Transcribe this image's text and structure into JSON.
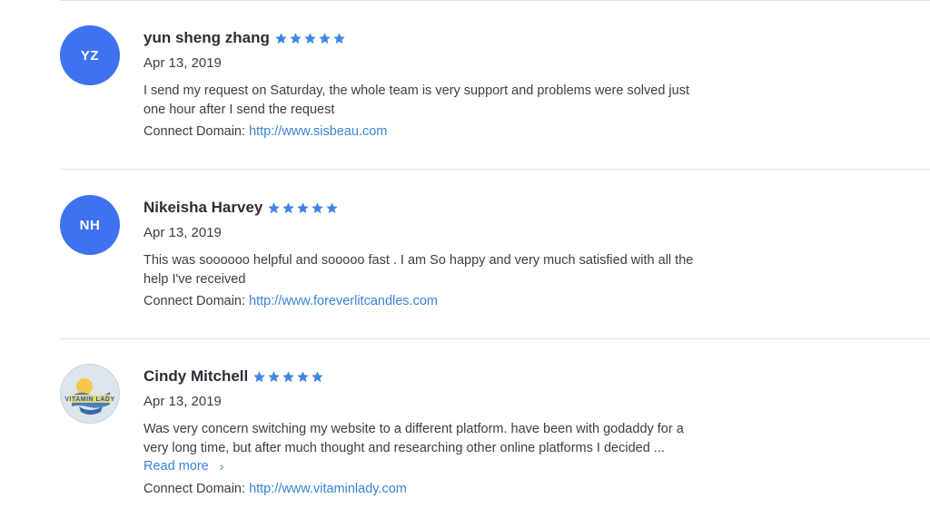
{
  "colors": {
    "accent": "#3a84d8",
    "star": "#3e86e3",
    "avatar_bg": "#3e72f0"
  },
  "reviews": [
    {
      "initials": "YZ",
      "name": "yun sheng zhang",
      "rating": 5,
      "date": "Apr 13, 2019",
      "text": "I send my request on Saturday,  the whole team is very support and problems were solved just one hour after I send the request",
      "domain_label": "Connect Domain:",
      "domain_url": "http://www.sisbeau.com"
    },
    {
      "initials": "NH",
      "name": "Nikeisha Harvey",
      "rating": 5,
      "date": "Apr 13, 2019",
      "text": "This was soooooo helpful and sooooo fast . I am So happy and very much satisfied with all the help I've received",
      "domain_label": "Connect Domain:",
      "domain_url": "http://www.foreverlitcandles.com"
    },
    {
      "avatar_logo_text": "VITAMIN LADY",
      "name": "Cindy Mitchell",
      "rating": 5,
      "date": "Apr 13, 2019",
      "text": "Was very concern switching my website to a different platform. have been with godaddy for a very long time, but after much thought and researching other online platforms I decided ...",
      "read_more": "Read more",
      "domain_label": "Connect Domain:",
      "domain_url": "http://www.vitaminlady.com"
    }
  ]
}
